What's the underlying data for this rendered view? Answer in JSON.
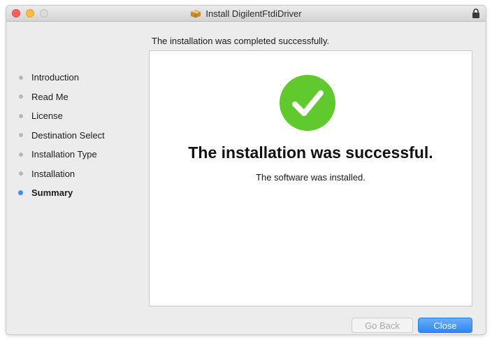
{
  "window": {
    "title": "Install DigilentFtdiDriver",
    "status_line": "The installation was completed successfully."
  },
  "steps": [
    {
      "label": "Introduction",
      "active": false
    },
    {
      "label": "Read Me",
      "active": false
    },
    {
      "label": "License",
      "active": false
    },
    {
      "label": "Destination Select",
      "active": false
    },
    {
      "label": "Installation Type",
      "active": false
    },
    {
      "label": "Installation",
      "active": false
    },
    {
      "label": "Summary",
      "active": true
    }
  ],
  "main": {
    "headline": "The installation was successful.",
    "subline": "The software was installed.",
    "success_icon": "checkmark-circle-icon",
    "success_color": "#5fc92e"
  },
  "buttons": {
    "back_label": "Go Back",
    "back_enabled": false,
    "close_label": "Close"
  },
  "colors": {
    "accent": "#3d8ef5",
    "inactive_dot": "#b8b8b8"
  }
}
